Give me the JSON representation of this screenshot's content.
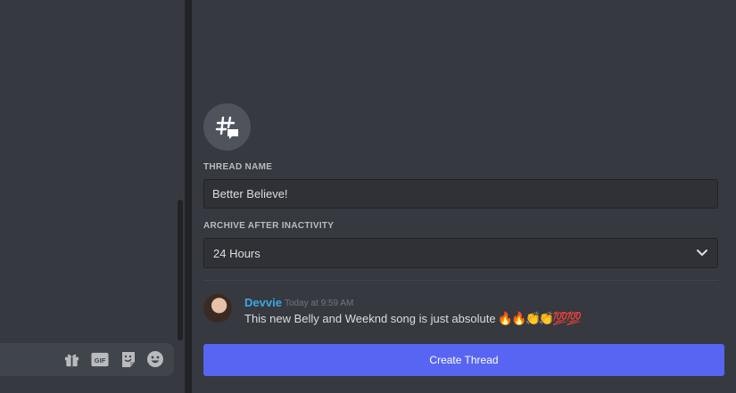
{
  "thread_form": {
    "name_label": "THREAD NAME",
    "name_value": "Better Believe!",
    "archive_label": "ARCHIVE AFTER INACTIVITY",
    "archive_value": "24 Hours"
  },
  "message": {
    "author": "Devvie",
    "timestamp": "Today at 9:59 AM",
    "text": "This new Belly and Weeknd song is just absolute",
    "emojis": "🔥🔥👏👏💯💯"
  },
  "actions": {
    "create_thread_label": "Create Thread"
  },
  "composer": {
    "tools": [
      "gift-icon",
      "gif-icon",
      "sticker-icon",
      "emoji-icon"
    ],
    "gif_label": "GIF"
  },
  "colors": {
    "background": "#36393f",
    "input_bg": "#2f3136",
    "author": "#3ba7e3",
    "button": "#5865f2"
  }
}
